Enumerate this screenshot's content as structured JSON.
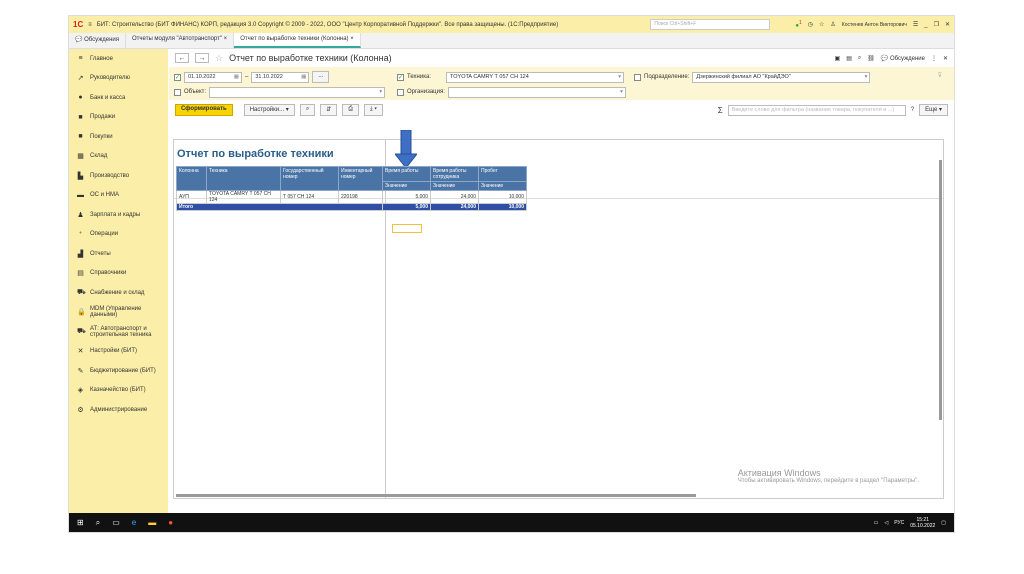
{
  "window": {
    "title": "БИТ: Строительство (БИТ ФИНАНС) КОРП, редакция 3.0 Copyright © 2009 - 2022, ООО \"Центр Корпоративной Поддержки\". Все права защищены. (1С:Предприятие)",
    "search_placeholder": "Поиск Ctrl+Shift+F",
    "user": "Костенев Антон Викторович",
    "notif_count": "1"
  },
  "tabs": [
    {
      "label": "Обсуждения"
    },
    {
      "label": "Отчеты модуля \"Автотранспорт\""
    },
    {
      "label": "Отчет по выработке техники (Колонна)"
    }
  ],
  "sidebar": {
    "items": [
      {
        "label": "Главное",
        "icon": "≡"
      },
      {
        "label": "Руководителю",
        "icon": "↗"
      },
      {
        "label": "Банк и касса",
        "icon": "●"
      },
      {
        "label": "Продажи",
        "icon": "■"
      },
      {
        "label": "Покупки",
        "icon": "■"
      },
      {
        "label": "Склад",
        "icon": "▦"
      },
      {
        "label": "Производство",
        "icon": "▙"
      },
      {
        "label": "ОС и НМА",
        "icon": "▬"
      },
      {
        "label": "Зарплата и кадры",
        "icon": "♟"
      },
      {
        "label": "Операции",
        "icon": "⁺"
      },
      {
        "label": "Отчеты",
        "icon": "▟"
      },
      {
        "label": "Справочники",
        "icon": "▤"
      },
      {
        "label": "Снабжение и склад",
        "icon": "⛟"
      },
      {
        "label": "MDM (Управление данными)",
        "icon": "🔒"
      },
      {
        "label": "АТ: Автотранспорт и строительная техника",
        "icon": "⛟"
      },
      {
        "label": "Настройки (БИТ)",
        "icon": "✕"
      },
      {
        "label": "Бюджетирование (БИТ)",
        "icon": "✎"
      },
      {
        "label": "Казначейство (БИТ)",
        "icon": "◈"
      },
      {
        "label": "Администрирование",
        "icon": "⚙"
      }
    ]
  },
  "header": {
    "title": "Отчет по выработке техники (Колонна)",
    "discussion": "Обсуждение"
  },
  "filters": {
    "date_from": "01.10.2022",
    "date_sep": "–",
    "date_to": "31.10.2022",
    "tech_label": "Техника:",
    "tech_value": "TOYOTA CAMRY Т 057 СН 124",
    "division_label": "Подразделение:",
    "division_value": "Дзержинский филиал АО \"КрайДЭО\"",
    "object_label": "Объект:",
    "org_label": "Организация:"
  },
  "toolbar": {
    "generate": "Сформировать",
    "settings": "Настройки...",
    "search_placeholder": "Введите слово для фильтра (название товара, покупателя и ...)",
    "help": "?",
    "more": "Еще"
  },
  "report": {
    "title": "Отчет по выработке техники",
    "headers": [
      "Колонна",
      "Техника",
      "Государственный номер",
      "Инвентарный номер",
      "Время работы",
      "Время работы сотрудника",
      "Пробег"
    ],
    "subheader": "Значение",
    "row": [
      "АУП",
      "TOYOTA CAMRY Т 057 СН 124",
      "Т 057 СН 124",
      "220198",
      "5,000",
      "24,000",
      "10,000"
    ],
    "total": {
      "label": "Итого",
      "values": [
        "5,000",
        "24,000",
        "10,000"
      ]
    }
  },
  "watermark": {
    "line1": "Активация Windows",
    "line2": "Чтобы активировать Windows, перейдите в раздел \"Параметры\"."
  },
  "taskbar": {
    "lang": "РУС",
    "time": "15:21",
    "date": "05.10.2022"
  }
}
